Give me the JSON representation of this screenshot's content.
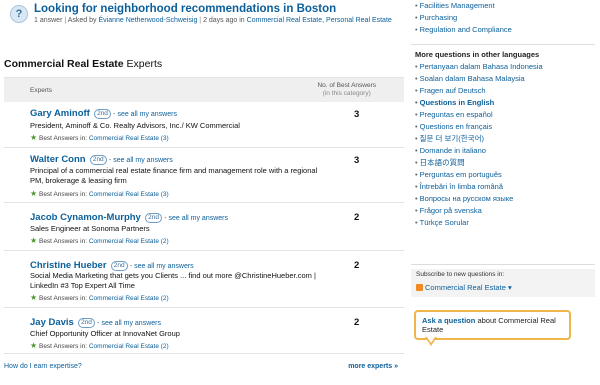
{
  "question": {
    "icon": "?",
    "title": "Looking for neighborhood recommendations in Boston",
    "answers": "1 answer",
    "asked_by_prefix": "Asked by",
    "asker": "Évianne Netherwood-Schweisig",
    "age": "2 days ago in",
    "categories": "Commercial Real Estate, Personal Real Estate"
  },
  "section": {
    "title_bold": "Commercial Real Estate",
    "title_rest": " Experts"
  },
  "table_head": {
    "experts": "Experts",
    "best_line1": "No. of Best Answers",
    "best_line2": "(in this category)"
  },
  "best_prefix": "Best Answers in:",
  "experts": [
    {
      "name": "Gary Aminoff",
      "degree": "2nd",
      "see_all": "see all my answers",
      "title": "President, Aminoff & Co. Realty Advisors, Inc./ KW Commercial",
      "best": "Commercial Real Estate (3)",
      "count": "3"
    },
    {
      "name": "Walter Conn",
      "degree": "2nd",
      "see_all": "see all my answers",
      "title": "Principal of a commercial real estate finance firm and management role with a regional PM, brokerage & leasing firm",
      "best": "Commercial Real Estate (3)",
      "count": "3"
    },
    {
      "name": "Jacob Cynamon-Murphy",
      "degree": "2nd",
      "see_all": "see all my answers",
      "title": "Sales Engineer at Sonoma Partners",
      "best": "Commercial Real Estate (2)",
      "count": "2"
    },
    {
      "name": "Christine Hueber",
      "degree": "2nd",
      "see_all": "see all my answers",
      "title": "Social Media Marketing that gets you Clients ... find out more @ChristineHueber.com | LinkedIn #3 Top Expert All Time",
      "best": "Commercial Real Estate (2)",
      "count": "2"
    },
    {
      "name": "Jay Davis",
      "degree": "2nd",
      "see_all": "see all my answers",
      "title": "Chief Opportunity Officer at InnovaNet Group",
      "best": "Commercial Real Estate (2)",
      "count": "2"
    }
  ],
  "footer": {
    "how": "How do I earn expertise?",
    "more": "more experts »"
  },
  "sidebar": {
    "top_items": [
      "Facilities Management",
      "Purchasing",
      "Regulation and Compliance"
    ],
    "lang_heading": "More questions in other languages",
    "languages": [
      "Pertanyaan dalam Bahasa Indonesia",
      "Soalan dalam Bahasa Malaysia",
      "Fragen auf Deutsch",
      "Questions in English",
      "Preguntas en español",
      "Questions en français",
      "질문 더 보기(한국어)",
      "Domande in italiano",
      "日本語の質問",
      "Perguntas em português",
      "Întrebări în limba română",
      "Вопросы на русском языке",
      "Frågor på svenska",
      "Türkçe Sorular"
    ],
    "active_language_index": 3,
    "subscribe_label": "Subscribe to new questions in:",
    "subscribe_link": "Commercial Real Estate",
    "ask_link": "Ask a question",
    "ask_rest": " about Commercial Real Estate"
  },
  "colors": {
    "link": "#0b5f9a",
    "star": "#4a9a2c",
    "callout_border": "#f0b54a",
    "rss": "#f28a23"
  }
}
